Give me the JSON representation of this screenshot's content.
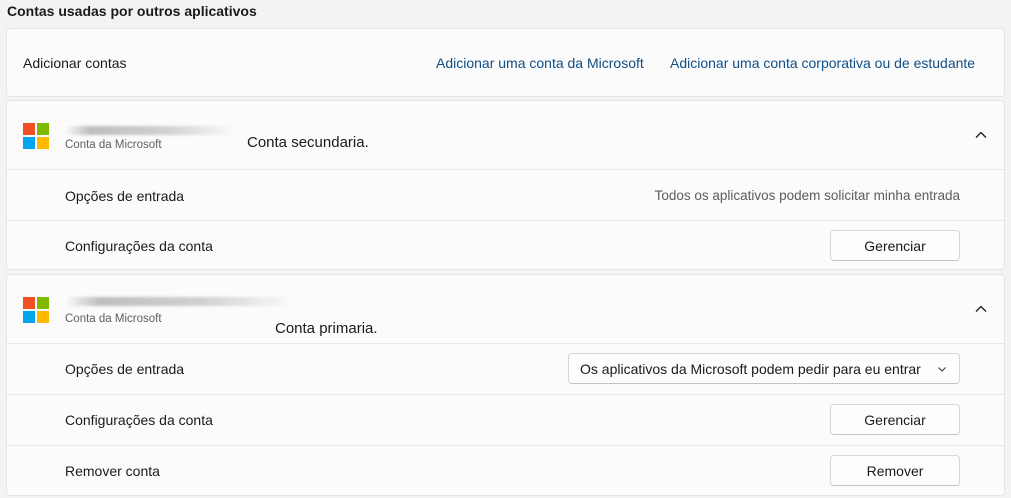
{
  "section_title": "Contas usadas por outros aplicativos",
  "add": {
    "label": "Adicionar contas",
    "link_microsoft": "Adicionar uma conta da Microsoft",
    "link_work": "Adicionar uma conta corporativa ou de estudante"
  },
  "accounts": [
    {
      "type_label": "Conta da Microsoft",
      "note": "Conta secundaria.",
      "signin_label": "Opções de entrada",
      "signin_value": "Todos os aplicativos podem solicitar minha entrada",
      "settings_label": "Configurações da conta",
      "manage_button": "Gerenciar",
      "expanded_icon": "chevron-up-icon"
    },
    {
      "type_label": "Conta da Microsoft",
      "note": "Conta primaria.",
      "signin_label": "Opções de entrada",
      "signin_dropdown_value": "Os aplicativos da Microsoft podem pedir para eu entrar",
      "settings_label": "Configurações da conta",
      "manage_button": "Gerenciar",
      "remove_label": "Remover conta",
      "remove_button": "Remover",
      "expanded_icon": "chevron-up-icon"
    }
  ],
  "colors": {
    "link": "#0f4f86",
    "page_bg": "#f3f3f3",
    "card_bg": "#fbfbfb",
    "ms_red": "#f25022",
    "ms_green": "#7fba00",
    "ms_blue": "#00a4ef",
    "ms_yellow": "#ffb900"
  }
}
